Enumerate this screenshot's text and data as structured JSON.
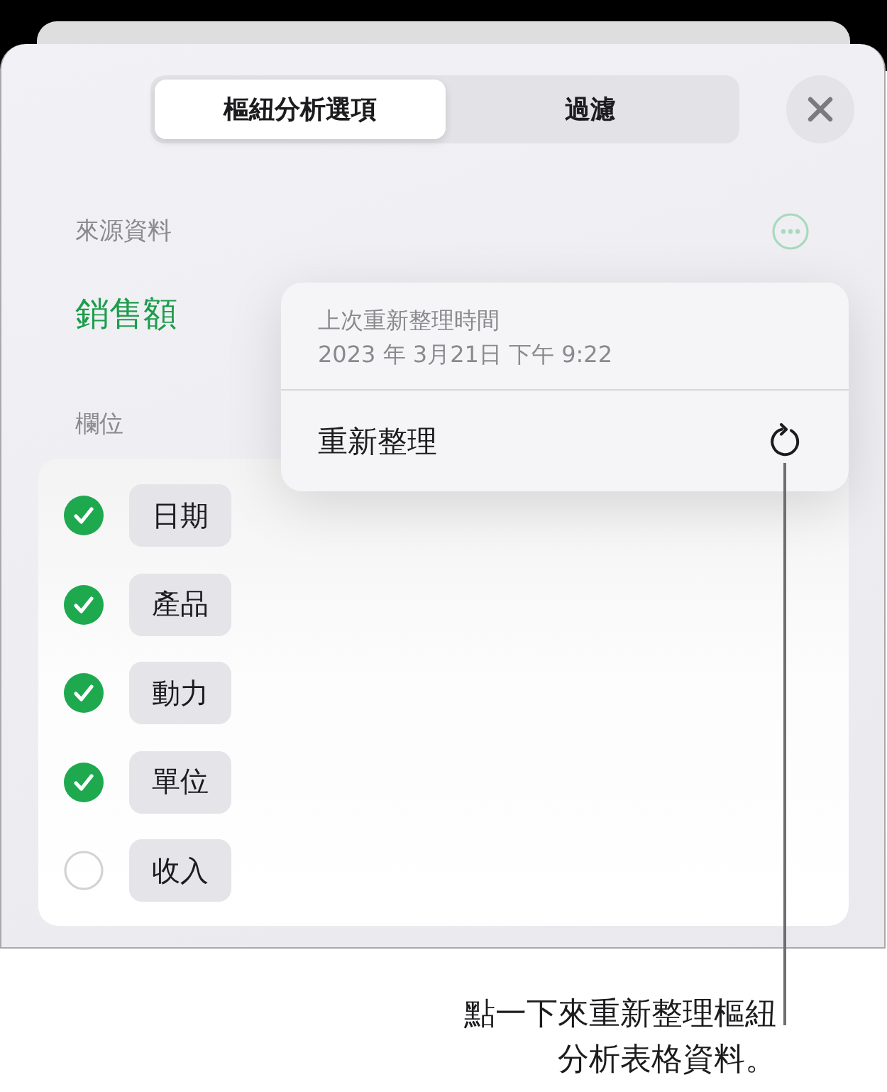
{
  "tabs": [
    {
      "label": "樞紐分析選項",
      "selected": true
    },
    {
      "label": "過濾",
      "selected": false
    }
  ],
  "source": {
    "label": "來源資料",
    "name": "銷售額"
  },
  "fields": {
    "label": "欄位",
    "items": [
      {
        "name": "日期",
        "checked": true
      },
      {
        "name": "產品",
        "checked": true
      },
      {
        "name": "動力",
        "checked": true
      },
      {
        "name": "單位",
        "checked": true
      },
      {
        "name": "收入",
        "checked": false
      }
    ]
  },
  "refresh_menu": {
    "caption": "上次重新整理時間",
    "timestamp": "2023 年 3月21日 下午 9:22",
    "action": "重新整理"
  },
  "callout": "點一下來重新整理樞紐分析表格資料。"
}
